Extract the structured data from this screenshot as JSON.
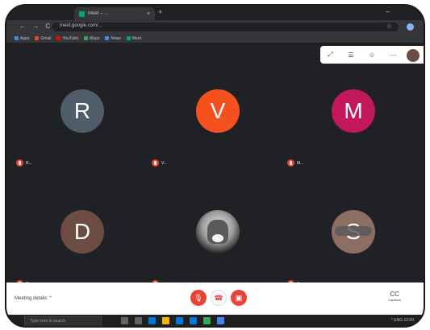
{
  "browser": {
    "tab_title": "Meet – ...",
    "tab_close": "×",
    "new_tab": "+",
    "minimize": "–",
    "nav_buttons": "← → C",
    "url": "meet.google.com/...",
    "star": "☆"
  },
  "bookmarks": [
    {
      "label": "Apps",
      "color": "#4285f4"
    },
    {
      "label": "Gmail",
      "color": "#ea4335"
    },
    {
      "label": "YouTube",
      "color": "#ff0000"
    },
    {
      "label": "Maps",
      "color": "#34a853"
    },
    {
      "label": "News",
      "color": "#4285f4"
    },
    {
      "label": "Meet",
      "color": "#00a86b"
    }
  ],
  "top_controls": [
    "⤢",
    "☰",
    "☺",
    "⋯"
  ],
  "participants": [
    {
      "initial": "R",
      "color": "#4e5d68",
      "name": "R...",
      "type": "initial"
    },
    {
      "initial": "V",
      "color": "#f4511e",
      "name": "V...",
      "type": "initial"
    },
    {
      "initial": "M",
      "color": "#c2185b",
      "name": "M...",
      "type": "initial"
    },
    {
      "initial": "D",
      "color": "#6d4c41",
      "name": "D...",
      "type": "initial"
    },
    {
      "initial": "",
      "color": "#9e9e9e",
      "name": "...",
      "type": "photo"
    },
    {
      "initial": "S",
      "color": "#8d6e63",
      "name": "S...",
      "type": "blur"
    }
  ],
  "bottom_bar": {
    "meeting_details": "Meeting details",
    "chevron": "⌃",
    "mic_icon": "🎙",
    "hangup_icon": "☎",
    "cam_icon": "▣",
    "captions": "CC",
    "captions_label": "Captions"
  },
  "taskbar": {
    "search_placeholder": "Type here to search",
    "icons": [
      "#5f6368",
      "#5f6368",
      "#0078d4",
      "#f4b400",
      "#0078d4",
      "#0078d4",
      "#34a853",
      "#4285f4"
    ],
    "tray": "^ ENG 12:00"
  }
}
